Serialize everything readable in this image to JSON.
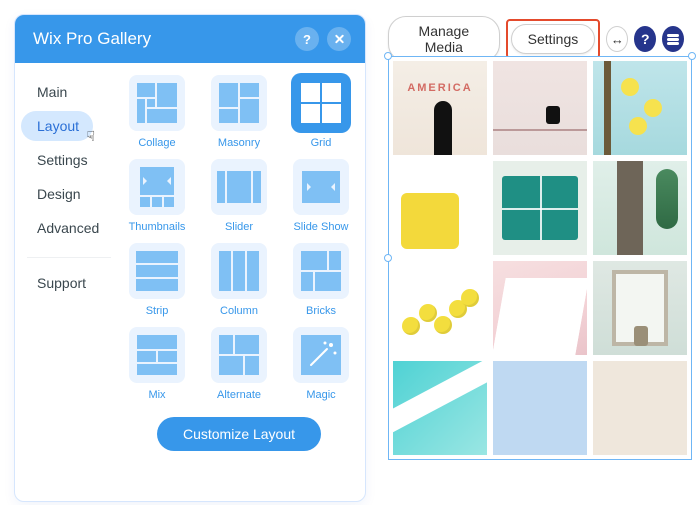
{
  "panel": {
    "title": "Wix Pro Gallery",
    "nav": {
      "items": [
        {
          "label": "Main"
        },
        {
          "label": "Layout"
        },
        {
          "label": "Settings"
        },
        {
          "label": "Design"
        },
        {
          "label": "Advanced"
        }
      ],
      "support": "Support",
      "active_index": 1
    },
    "layouts": [
      {
        "label": "Collage"
      },
      {
        "label": "Masonry"
      },
      {
        "label": "Grid"
      },
      {
        "label": "Thumbnails"
      },
      {
        "label": "Slider"
      },
      {
        "label": "Slide Show"
      },
      {
        "label": "Strip"
      },
      {
        "label": "Column"
      },
      {
        "label": "Bricks"
      },
      {
        "label": "Mix"
      },
      {
        "label": "Alternate"
      },
      {
        "label": "Magic"
      }
    ],
    "selected_layout_index": 2,
    "customize_label": "Customize Layout"
  },
  "toolbar": {
    "manage_media": "Manage Media",
    "settings": "Settings",
    "help_glyph": "?",
    "stretch_glyph": "↔"
  },
  "colors": {
    "accent": "#3797ea",
    "highlight": "#e44a2c",
    "selection": "#6fb6f5"
  }
}
